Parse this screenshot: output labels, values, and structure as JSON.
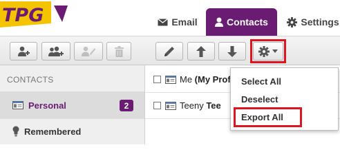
{
  "brand": {
    "name": "TPG",
    "color_purple": "#6a1b72",
    "color_yellow": "#f5c400"
  },
  "nav": {
    "email": {
      "label": "Email",
      "icon": "envelope-icon"
    },
    "contacts": {
      "label": "Contacts",
      "icon": "person-icon",
      "active": true
    },
    "settings": {
      "label": "Settings",
      "icon": "gear-icon"
    }
  },
  "toolbar": {
    "buttons": [
      {
        "name": "add-contact",
        "icon": "add-person-icon",
        "enabled": true
      },
      {
        "name": "add-group",
        "icon": "add-group-icon",
        "enabled": true
      },
      {
        "name": "edit-contact-disabled",
        "icon": "person-pencil-icon",
        "enabled": false
      },
      {
        "name": "delete",
        "icon": "trash-icon",
        "enabled": false
      },
      {
        "name": "edit",
        "icon": "pencil-icon",
        "enabled": true
      },
      {
        "name": "move-up",
        "icon": "arrow-up-icon",
        "enabled": true
      },
      {
        "name": "move-down",
        "icon": "arrow-down-icon",
        "enabled": true
      },
      {
        "name": "actions-menu",
        "icon": "gear-icon",
        "enabled": true,
        "highlighted": true
      }
    ],
    "highlight_color": "#e0141e"
  },
  "sidebar": {
    "heading": "CONTACTS",
    "items": [
      {
        "label": "Personal",
        "count": "2",
        "icon": "contact-card-icon",
        "selected": true
      },
      {
        "label": "Remembered",
        "icon": "lightbulb-icon",
        "selected": false
      }
    ]
  },
  "contacts": [
    {
      "name_prefix": "Me ",
      "name_bold": "(My Prof",
      "icon": "contact-card-icon",
      "checked": false
    },
    {
      "name_prefix": "Teeny ",
      "name_bold": "Tee",
      "icon": "contact-card-icon",
      "checked": false
    }
  ],
  "menu": {
    "items": [
      {
        "label": "Select All"
      },
      {
        "label": "Deselect"
      },
      {
        "label": "Export All",
        "highlighted": true
      }
    ]
  }
}
